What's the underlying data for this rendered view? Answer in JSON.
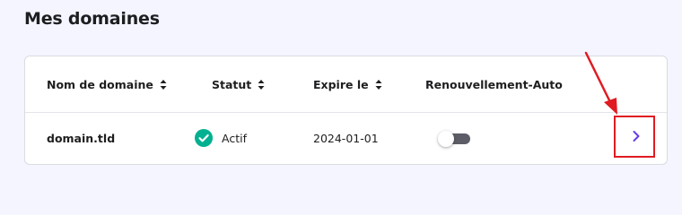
{
  "page": {
    "title": "Mes domaines"
  },
  "table": {
    "columns": [
      {
        "label": "Nom de domaine",
        "sortable": true
      },
      {
        "label": "Statut",
        "sortable": true
      },
      {
        "label": "Expire le",
        "sortable": true
      },
      {
        "label": "Renouvellement-Auto",
        "sortable": false
      }
    ],
    "rows": [
      {
        "domain": "domain.tld",
        "status": "Actif",
        "status_icon": "check-circle-icon",
        "expires": "2024-01-01",
        "auto_renew": false,
        "action_icon": "chevron-right-icon"
      }
    ]
  },
  "colors": {
    "background": "#f4f5ff",
    "status_active": "#00b090",
    "accent": "#673de6",
    "toggle_off": "#5c5d66",
    "annotation": "#e01b22"
  }
}
